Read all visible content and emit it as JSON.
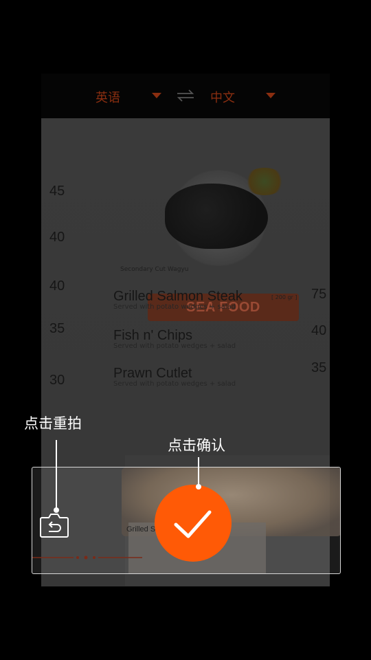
{
  "lang_bar": {
    "source_lang": "英语",
    "target_lang": "中文",
    "swap_icon": "swap-arrows-icon",
    "accent_color": "#8a2e10"
  },
  "photo": {
    "caption": "Secondary Cut Wagyu",
    "prices_left": [
      "45",
      "40",
      "40",
      "35",
      "30"
    ],
    "section_title": "SEA FOOD",
    "dishes": [
      {
        "name": "Grilled Salmon Steak",
        "desc": "Served with potato wedges + salad",
        "size": "[ 200 gr ]",
        "price": "75"
      },
      {
        "name": "Fish n' Chips",
        "desc": "Served with potato wedges + salad",
        "price": "40"
      },
      {
        "name": "Prawn Cutlet",
        "desc": "Served with potato wedges + salad",
        "price": "35"
      }
    ],
    "bottom_label": "Grilled S"
  },
  "actions": {
    "retake_icon": "retake-camera-icon",
    "confirm_icon": "checkmark-icon",
    "confirm_color": "#ff5a06"
  },
  "tips": {
    "retake": "点击重拍",
    "confirm": "点击确认"
  }
}
